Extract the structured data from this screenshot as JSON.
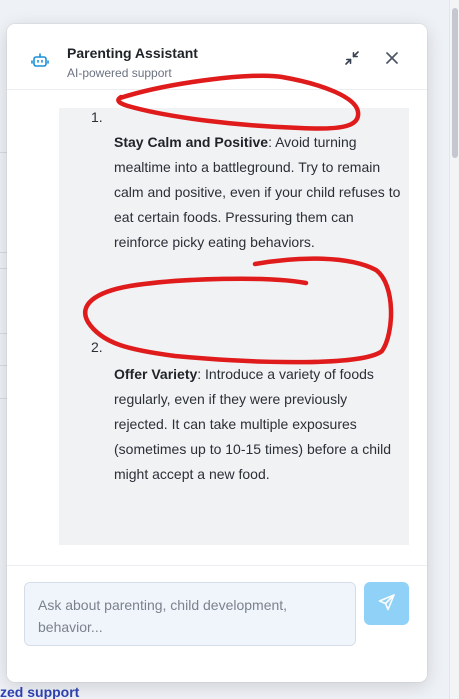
{
  "background": {
    "footer_link_text": "zed support"
  },
  "header": {
    "title": "Parenting Assistant",
    "subtitle": "AI-powered support",
    "icon": "robot-icon",
    "minimize_icon": "collapse-arrows-icon",
    "close_icon": "close-icon"
  },
  "messages": {
    "list_items": [
      {
        "number": "1.",
        "heading": "Stay Calm and Positive",
        "body": ": Avoid turning mealtime into a battleground. Try to remain calm and positive, even if your child refuses to eat certain foods. Pressuring them can reinforce picky eating behaviors."
      },
      {
        "number": "2.",
        "heading": "Offer Variety",
        "body": ": Introduce a variety of foods regularly, even if they were previously rejected. It can take multiple exposures (sometimes up to 10-15 times) before a child might accept a new food."
      }
    ]
  },
  "composer": {
    "placeholder": "Ask about parenting, child development, behavior...",
    "value": "",
    "send_icon": "send-icon"
  },
  "colors": {
    "accent": "#8fd1f7",
    "brand_icon": "#1d8fd8",
    "annotation": "#e01b1b",
    "bubble_bg": "#f1f2f4"
  }
}
